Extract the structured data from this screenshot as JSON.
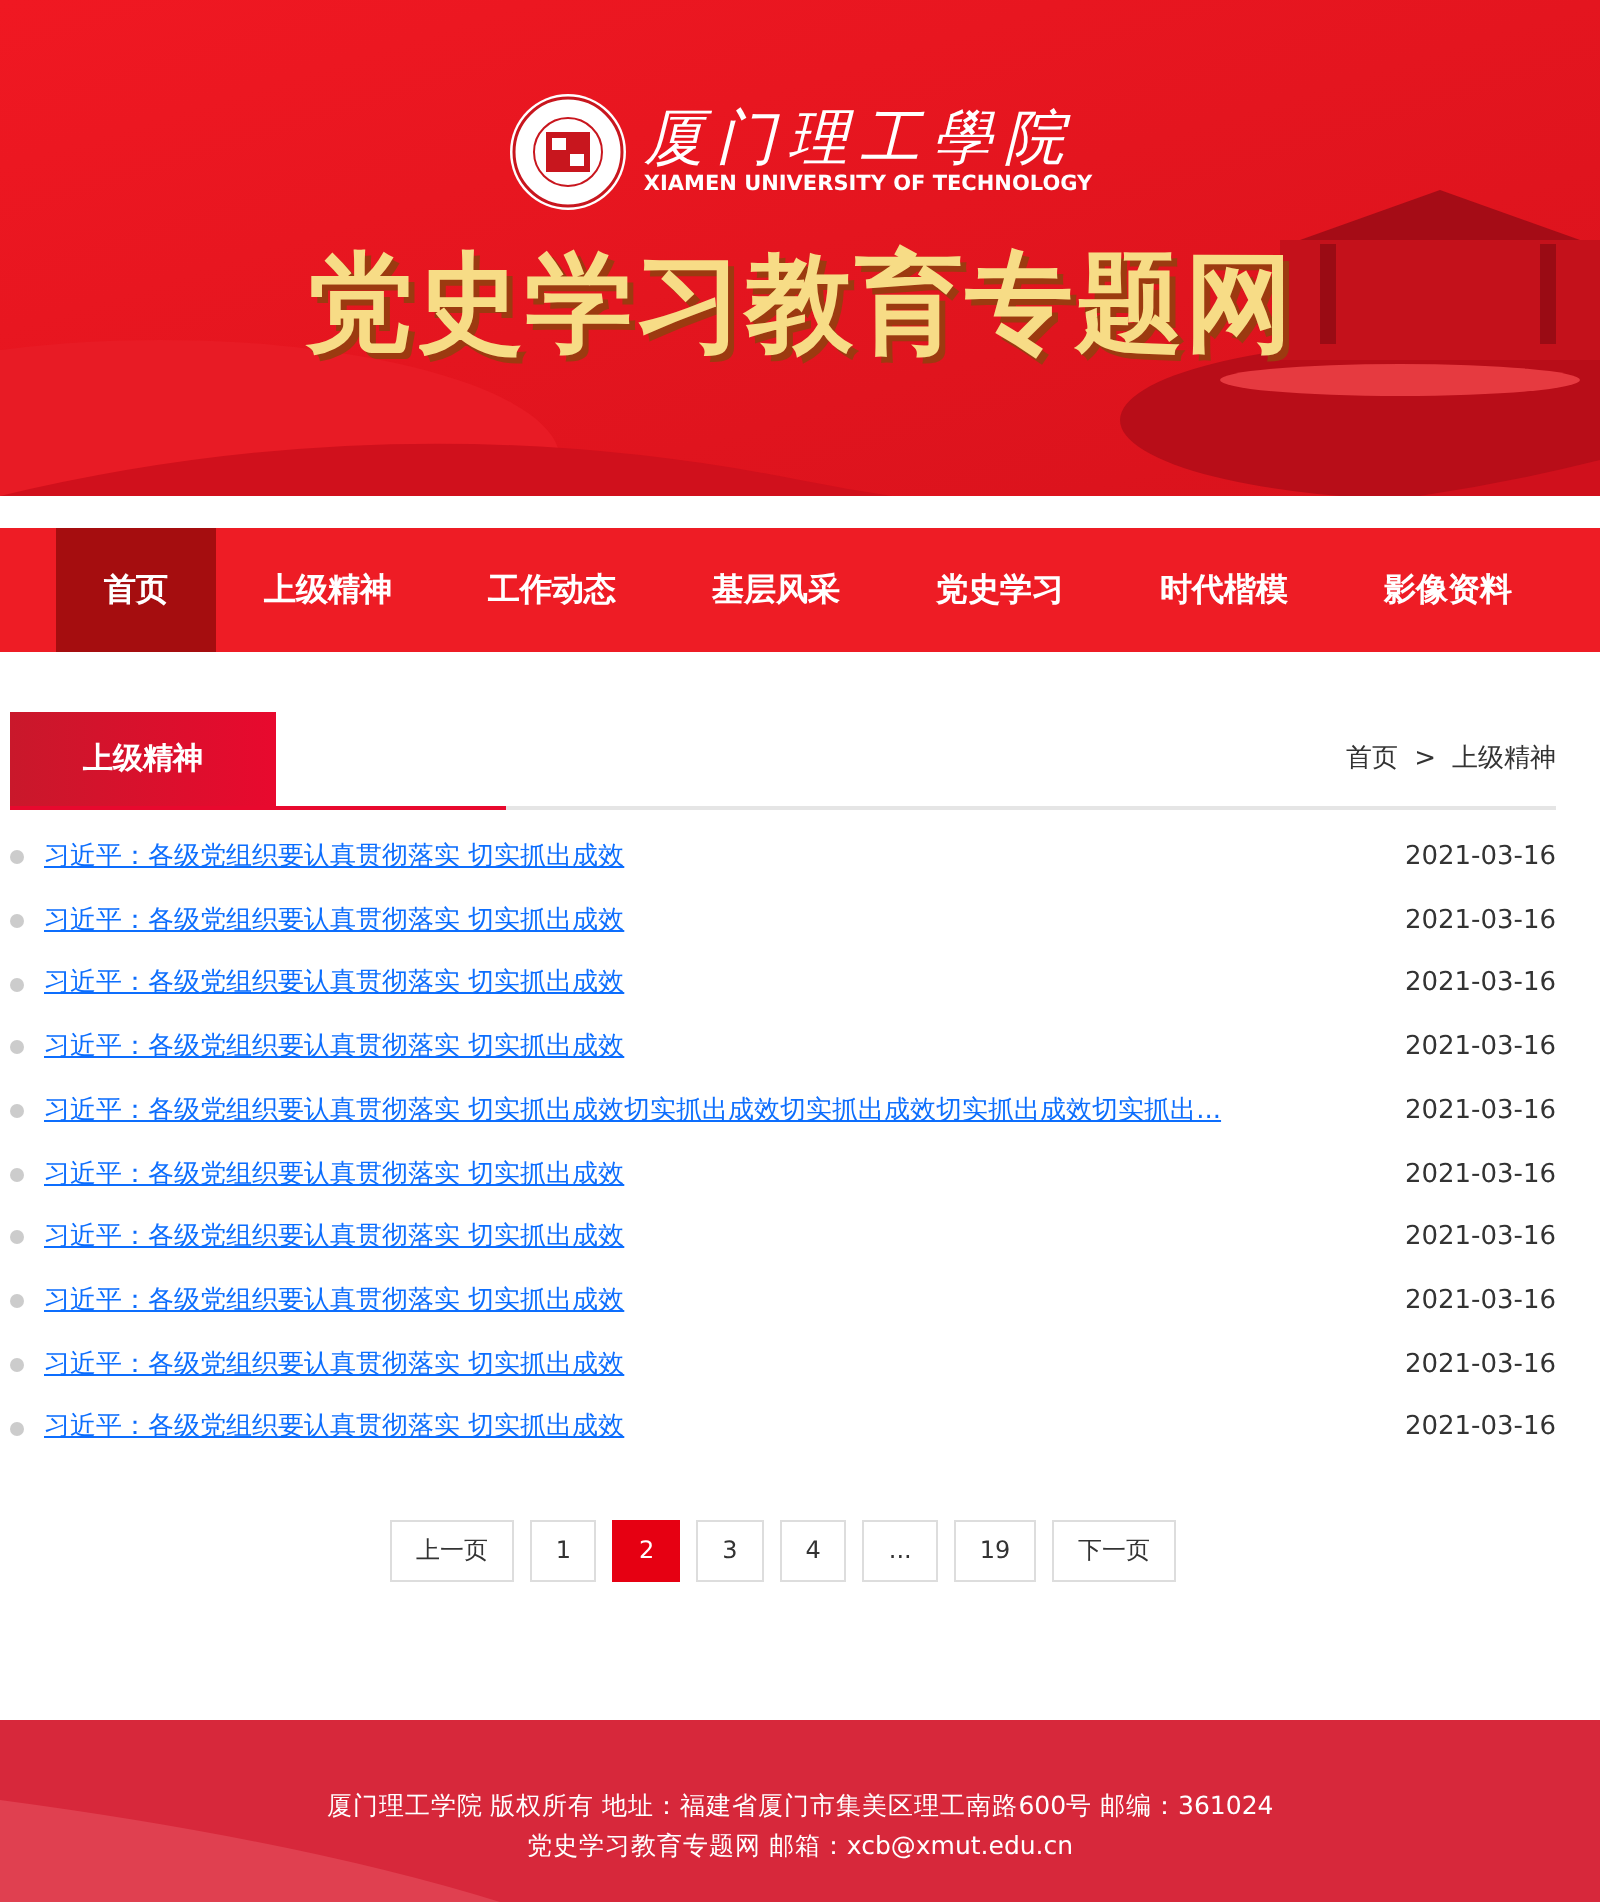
{
  "header": {
    "school_name": "厦门理工學院",
    "school_name_en": "XIAMEN UNIVERSITY OF TECHNOLOGY",
    "site_title": "党史学习教育专题网"
  },
  "nav": [
    {
      "label": "首页",
      "selected": true
    },
    {
      "label": "上级精神",
      "selected": false
    },
    {
      "label": "工作动态",
      "selected": false
    },
    {
      "label": "基层风采",
      "selected": false
    },
    {
      "label": "党史学习",
      "selected": false
    },
    {
      "label": "时代楷模",
      "selected": false
    },
    {
      "label": "影像资料",
      "selected": false
    }
  ],
  "section": {
    "title": "上级精神",
    "breadcrumb": [
      "首页",
      "上级精神"
    ],
    "separator": ">"
  },
  "articles": [
    {
      "title": "习近平：各级党组织要认真贯彻落实 切实抓出成效",
      "date": "2021-03-16"
    },
    {
      "title": "习近平：各级党组织要认真贯彻落实 切实抓出成效",
      "date": "2021-03-16"
    },
    {
      "title": "习近平：各级党组织要认真贯彻落实 切实抓出成效",
      "date": "2021-03-16"
    },
    {
      "title": "习近平：各级党组织要认真贯彻落实 切实抓出成效",
      "date": "2021-03-16"
    },
    {
      "title": "习近平：各级党组织要认真贯彻落实 切实抓出成效切实抓出成效切实抓出成效切实抓出成效切实抓出...",
      "date": "2021-03-16"
    },
    {
      "title": "习近平：各级党组织要认真贯彻落实 切实抓出成效",
      "date": "2021-03-16"
    },
    {
      "title": "习近平：各级党组织要认真贯彻落实 切实抓出成效",
      "date": "2021-03-16"
    },
    {
      "title": "习近平：各级党组织要认真贯彻落实 切实抓出成效",
      "date": "2021-03-16"
    },
    {
      "title": "习近平：各级党组织要认真贯彻落实 切实抓出成效",
      "date": "2021-03-16"
    },
    {
      "title": "习近平：各级党组织要认真贯彻落实 切实抓出成效",
      "date": "2021-03-16"
    }
  ],
  "pagination": [
    {
      "label": "上一页",
      "selected": false
    },
    {
      "label": "1",
      "selected": false
    },
    {
      "label": "2",
      "selected": true
    },
    {
      "label": "3",
      "selected": false
    },
    {
      "label": "4",
      "selected": false
    },
    {
      "label": "...",
      "selected": false
    },
    {
      "label": "19",
      "selected": false
    },
    {
      "label": "下一页",
      "selected": false
    }
  ],
  "footer": [
    "厦门理工学院 版权所有 地址：福建省厦门市集美区理工南路600号 邮编：361024",
    "党史学习教育专题网 邮箱：xcb@xmut.edu.cn"
  ]
}
